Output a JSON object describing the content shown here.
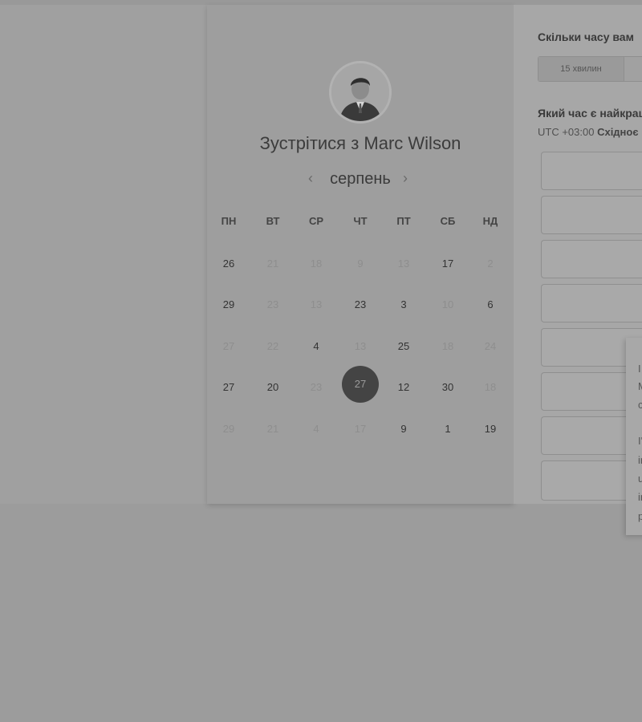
{
  "calendar": {
    "title": "Зустрітися з Marc Wilson",
    "month": "серпень",
    "prev_icon": "‹",
    "next_icon": "›",
    "weekdays": [
      "ПН",
      "ВТ",
      "СР",
      "ЧТ",
      "ПТ",
      "СБ",
      "НД"
    ],
    "weeks": [
      [
        "26",
        "21",
        "18",
        "9",
        "13",
        "17",
        "2"
      ],
      [
        "29",
        "23",
        "13",
        "23",
        "3",
        "10",
        "6"
      ],
      [
        "27",
        "22",
        "4",
        "13",
        "25",
        "18",
        "24"
      ],
      [
        "27",
        "20",
        "23",
        "27",
        "12",
        "30",
        "18"
      ],
      [
        "29",
        "21",
        "4",
        "17",
        "9",
        "1",
        "19"
      ]
    ],
    "selected_day": "27"
  },
  "duration": {
    "question": "Скільки часу вам",
    "option_15": "15 хвилин"
  },
  "time": {
    "question": "Який час є найкращ",
    "tz_offset": "UTC +03:00",
    "tz_name": "Східноє"
  },
  "popup": {
    "lines": [
      "I",
      "M",
      "c",
      "",
      "I'",
      "ir",
      "u",
      "ir",
      "p"
    ]
  },
  "colors": {
    "selected_day_bg": "#444444"
  }
}
